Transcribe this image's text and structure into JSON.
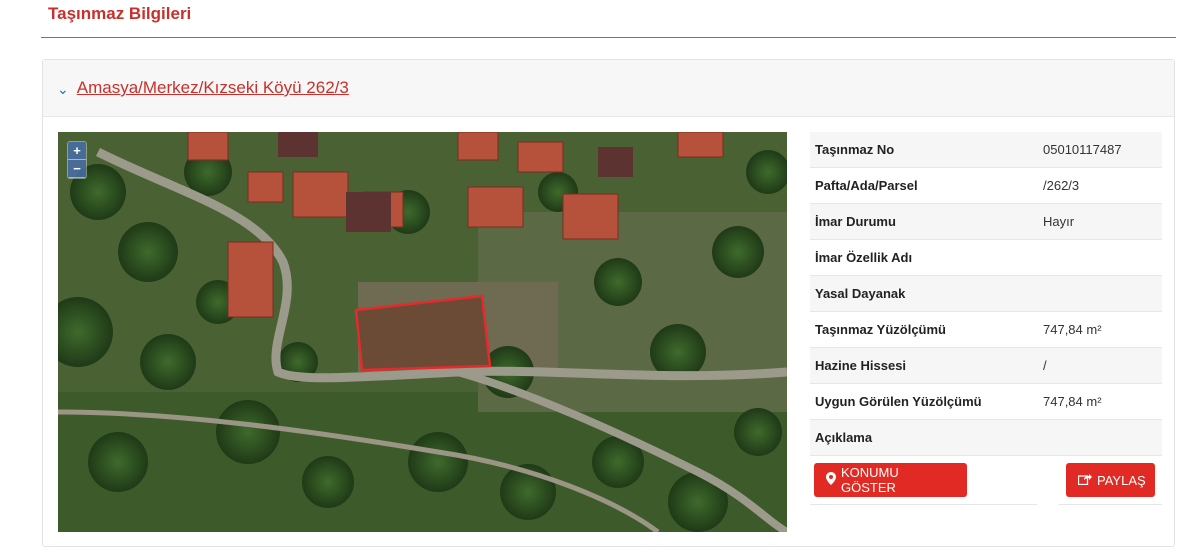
{
  "page_title": "Taşınmaz Bilgileri",
  "parcel": {
    "path_label": "Amasya/Merkez/Kızseki Köyü 262/3"
  },
  "map": {
    "zoom_in": "+",
    "zoom_out": "−"
  },
  "details": [
    {
      "label": "Taşınmaz No",
      "value": "05010117487"
    },
    {
      "label": "Pafta/Ada/Parsel",
      "value": "/262/3"
    },
    {
      "label": "İmar Durumu",
      "value": "Hayır"
    },
    {
      "label": "İmar Özellik Adı",
      "value": ""
    },
    {
      "label": "Yasal Dayanak",
      "value": ""
    },
    {
      "label": "Taşınmaz Yüzölçümü",
      "value": "747,84 m²"
    },
    {
      "label": "Hazine Hissesi",
      "value": "/"
    },
    {
      "label": "Uygun Görülen Yüzölçümü",
      "value": "747,84 m²"
    },
    {
      "label": "Açıklama",
      "value": ""
    }
  ],
  "actions": {
    "show_location": "KONUMU GÖSTER",
    "share": "PAYLAŞ"
  },
  "colors": {
    "accent": "#e12a23",
    "title": "#c9302c",
    "parcel_outline": "#e32b2b"
  },
  "icons": {
    "show_location": "map-marker-icon",
    "share": "share-icon",
    "expand": "chevron-down-icon"
  }
}
